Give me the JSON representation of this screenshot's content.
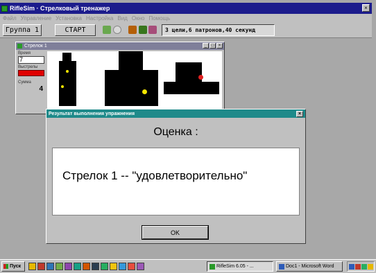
{
  "app": {
    "title": "RifleSim · Стрелковый тренажер",
    "menu": [
      "Файл",
      "Управление",
      "Установка",
      "Настройка",
      "Вид",
      "Окно",
      "Помощь"
    ]
  },
  "toolbar": {
    "group_label": "Группа 1",
    "start_label": "СТАРТ",
    "info": "3 цели,6 патронов,40 секунд"
  },
  "child_window": {
    "title": "Стрелок 1",
    "time_label": "Время",
    "time_value": "7",
    "shots_label": "Выстрелы",
    "score_label": "Сумма",
    "score_value": "4"
  },
  "dialog": {
    "title": "Результат выполнения упражнения",
    "heading": "Оценка :",
    "message": "Стрелок 1 -- \"удовлетворительно\"",
    "ok_label": "OK"
  },
  "taskbar": {
    "start_label": "Пуск",
    "items": [
      {
        "label": "RifleSim 6.05 - ..."
      },
      {
        "label": "Doc1 - Microsoft Word"
      }
    ]
  },
  "colors": {
    "titlebar": "#1c1c8c",
    "dialog_titlebar": "#1e8a8a",
    "shots_bar": "#e00000",
    "hit_yellow": "#f5e600",
    "hit_red": "#e02020"
  }
}
